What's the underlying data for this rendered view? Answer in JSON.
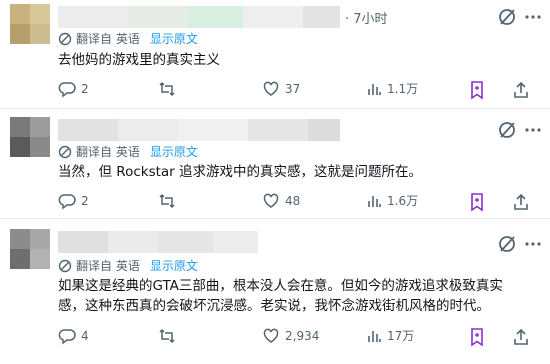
{
  "posts": [
    {
      "time": "· 7小时",
      "translate_label": "翻译自 英语",
      "show_original": "显示原文",
      "text_lines": [
        "去他妈的游戏里的真实主义"
      ],
      "replies": "2",
      "reposts": "",
      "likes": "37",
      "views": "1.1万"
    },
    {
      "time": "",
      "translate_label": "翻译自 英语",
      "show_original": "显示原文",
      "text_lines": [
        "当然，但 Rockstar 追求游戏中的真实感，这就是问题所在。"
      ],
      "replies": "2",
      "reposts": "",
      "likes": "48",
      "views": "1.6万"
    },
    {
      "time": "",
      "translate_label": "翻译自 英语",
      "show_original": "显示原文",
      "text_lines": [
        "如果这是经典的GTA三部曲，根本没人会在意。但如今的游戏追求极致真实",
        "感，这种东西真的会破坏沉浸感。老实说，我怀念游戏街机风格的时代。"
      ],
      "replies": "4",
      "reposts": "",
      "likes": "2,934",
      "views": "17万"
    }
  ],
  "icons": [
    "grok-icon",
    "more-icon",
    "translate-icon",
    "reply-icon",
    "repost-icon",
    "like-icon",
    "views-icon",
    "bookmark-icon",
    "share-icon"
  ],
  "colors": {
    "link": "#1d9bf0",
    "muted": "#536471",
    "grok_purple": "#8b2fd0"
  }
}
